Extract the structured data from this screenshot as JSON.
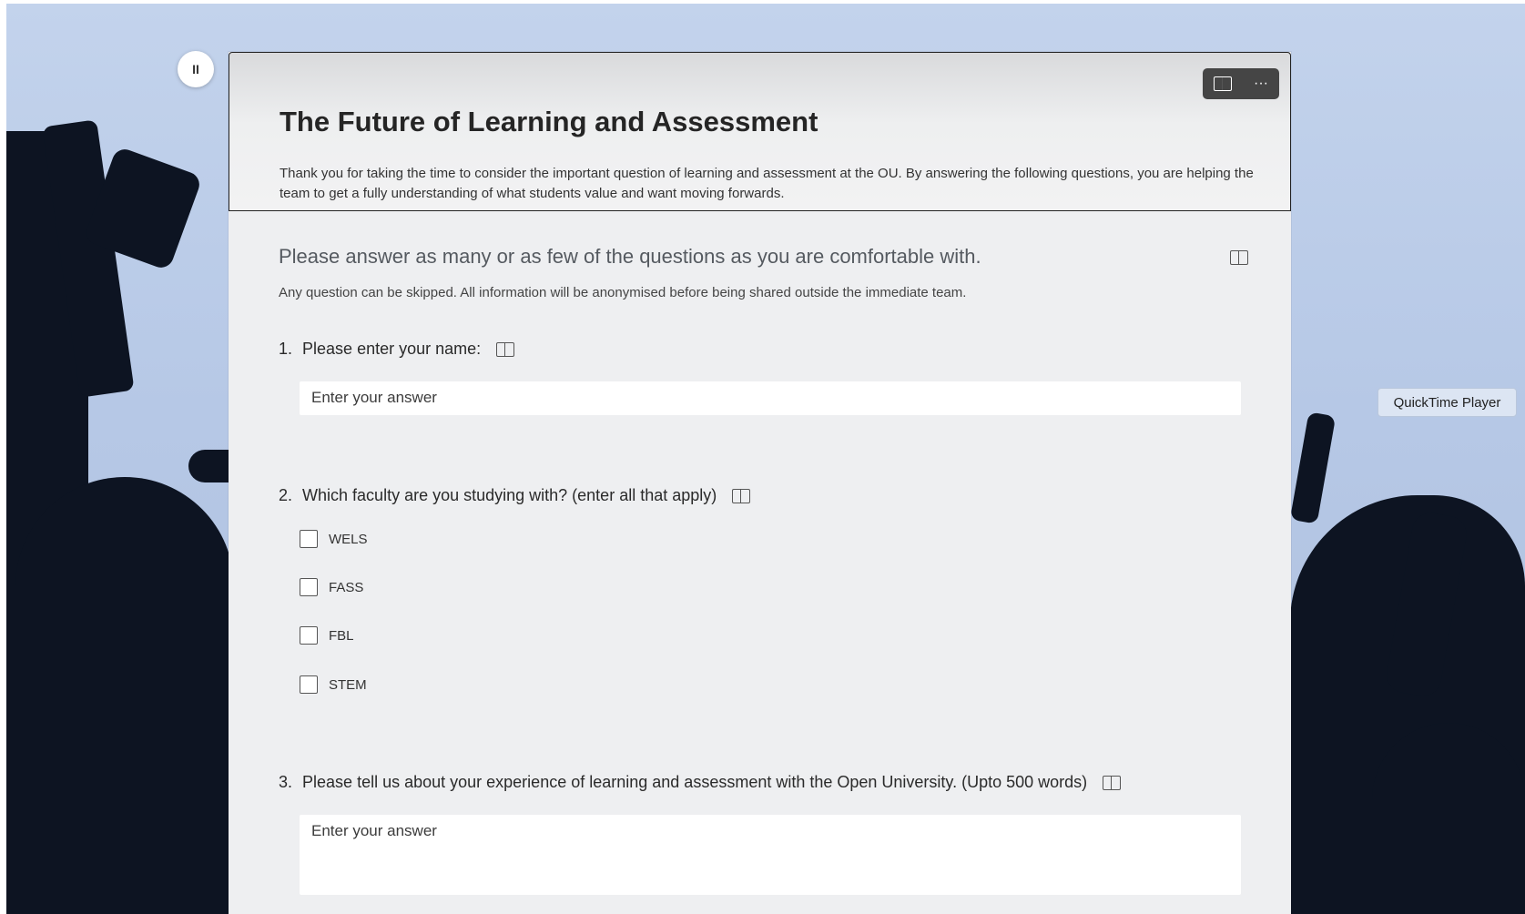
{
  "form": {
    "title": "The Future of Learning and Assessment",
    "description": "Thank you for taking the time to consider the important question of learning and assessment at the OU. By answering the following questions, you are helping the team to get a fully understanding of what students value and want moving forwards.",
    "header_buttons": {
      "immersive_reader_icon": "immersive-reader-icon",
      "more_label": "···"
    },
    "section": {
      "heading": "Please answer as many or as few of the questions as you are comfortable with.",
      "note": "Any question can be skipped. All information will be anonymised before being shared outside the immediate team."
    },
    "questions": [
      {
        "number": "1.",
        "text": "Please enter your name:",
        "placeholder": "Enter your answer"
      },
      {
        "number": "2.",
        "text": "Which faculty are you studying with? (enter all that apply)",
        "options": [
          "WELS",
          "FASS",
          "FBL",
          "STEM"
        ]
      },
      {
        "number": "3.",
        "text": "Please tell us about your experience of learning and assessment with the Open University. (Upto 500 words)",
        "placeholder": "Enter your answer"
      }
    ]
  },
  "overlay": {
    "pause_label": "II",
    "quicktime_label": "QuickTime Player"
  },
  "colors": {
    "header_button_bg": "#454545",
    "form_bg": "#eeeff1",
    "sky": "#c3d3ec"
  }
}
